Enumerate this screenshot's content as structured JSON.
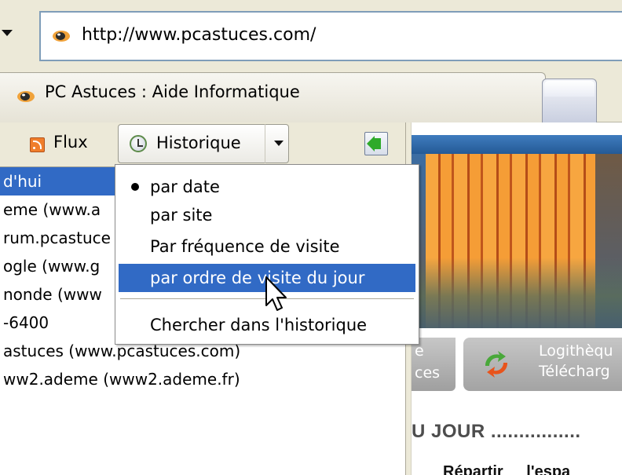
{
  "address_bar": {
    "url": "http://www.pcastuces.com/"
  },
  "tabs": [
    {
      "title": "PC Astuces : Aide Informatique",
      "active": true
    },
    {
      "title": "",
      "active": false
    }
  ],
  "sidebar": {
    "feeds_label": "Flux",
    "view_select": {
      "selected_label": "Historique"
    },
    "tree_items": [
      {
        "label": "d'hui",
        "selected": true
      },
      {
        "label": "eme (www.a",
        "selected": false
      },
      {
        "label": "rum.pcastuce",
        "selected": false
      },
      {
        "label": "ogle (www.g",
        "selected": false
      },
      {
        "label": "nonde (www",
        "selected": false
      },
      {
        "label": "-6400",
        "selected": false
      },
      {
        "label": "astuces (www.pcastuces.com)",
        "selected": false
      },
      {
        "label": "ww2.ademe (www2.ademe.fr)",
        "selected": false
      }
    ]
  },
  "history_menu": {
    "items": [
      {
        "label": "par date",
        "checked": true,
        "highlighted": false
      },
      {
        "label": "par site",
        "checked": false,
        "highlighted": false
      },
      {
        "label": "Par fréquence de visite",
        "checked": false,
        "highlighted": false
      },
      {
        "label": "par ordre de visite du jour",
        "checked": false,
        "highlighted": true
      }
    ],
    "search_item": {
      "label": "Chercher dans l'historique"
    }
  },
  "web_content": {
    "nav_tab_left_lines": [
      "e",
      "ces"
    ],
    "nav_tab_right_lines": [
      "Logithèqu",
      "Télécharg"
    ],
    "section_title": "U JOUR ................",
    "row_words": [
      "Répartir",
      "l'espa"
    ]
  },
  "colors": {
    "selection_blue": "#316ac5",
    "chrome_beige": "#ece9d8",
    "address_border": "#7f9db9"
  },
  "icons": {
    "site_favicon": "pcastuces-favicon",
    "feeds": "rss-icon",
    "history": "history-clock-icon",
    "close_sidebar": "green-arrow-icon",
    "dropdown": "chevron-down-icon",
    "logitheque": "recycle-arrows-icon",
    "cursor": "mouse-pointer-icon"
  }
}
